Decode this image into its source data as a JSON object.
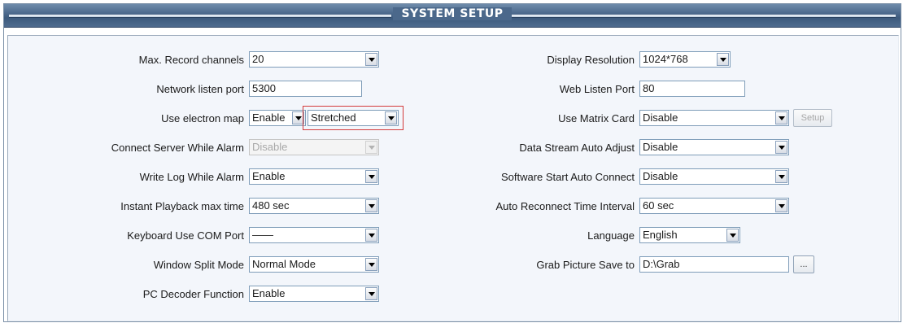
{
  "window": {
    "title": "SYSTEM SETUP"
  },
  "left": [
    {
      "label": "Max. Record channels",
      "type": "combo",
      "value": "20"
    },
    {
      "label": "Network listen port",
      "type": "text",
      "value": "5300"
    },
    {
      "label": "Use electron map",
      "type": "double-combo",
      "value": "Enable",
      "value2": "Stretched"
    },
    {
      "label": "Connect Server While Alarm",
      "type": "combo",
      "value": "Disable",
      "disabled": true
    },
    {
      "label": "Write Log While Alarm",
      "type": "combo",
      "value": "Enable"
    },
    {
      "label": "Instant Playback max time",
      "type": "combo",
      "value": "480 sec"
    },
    {
      "label": "Keyboard Use COM Port",
      "type": "combo",
      "value": "——"
    },
    {
      "label": "Window Split Mode",
      "type": "combo",
      "value": "Normal Mode"
    },
    {
      "label": "PC Decoder Function",
      "type": "combo",
      "value": "Enable"
    }
  ],
  "right": [
    {
      "label": "Display Resolution",
      "type": "combo",
      "value": "1024*768"
    },
    {
      "label": "Web Listen Port",
      "type": "text",
      "value": "80"
    },
    {
      "label": "Use Matrix Card",
      "type": "combo",
      "value": "Disable",
      "button": "Setup"
    },
    {
      "label": "Data Stream Auto Adjust",
      "type": "combo",
      "value": "Disable"
    },
    {
      "label": "Software Start Auto Connect",
      "type": "combo",
      "value": "Disable"
    },
    {
      "label": "Auto Reconnect Time Interval",
      "type": "combo",
      "value": "60 sec"
    },
    {
      "label": "Language",
      "type": "combo",
      "value": "English"
    },
    {
      "label": "Grab Picture Save to",
      "type": "text",
      "value": "D:\\Grab",
      "button": "..."
    }
  ],
  "colors": {
    "title_bar": "#4d6a8d",
    "panel": "#f3f6fb",
    "highlight": "#d33b3b"
  }
}
